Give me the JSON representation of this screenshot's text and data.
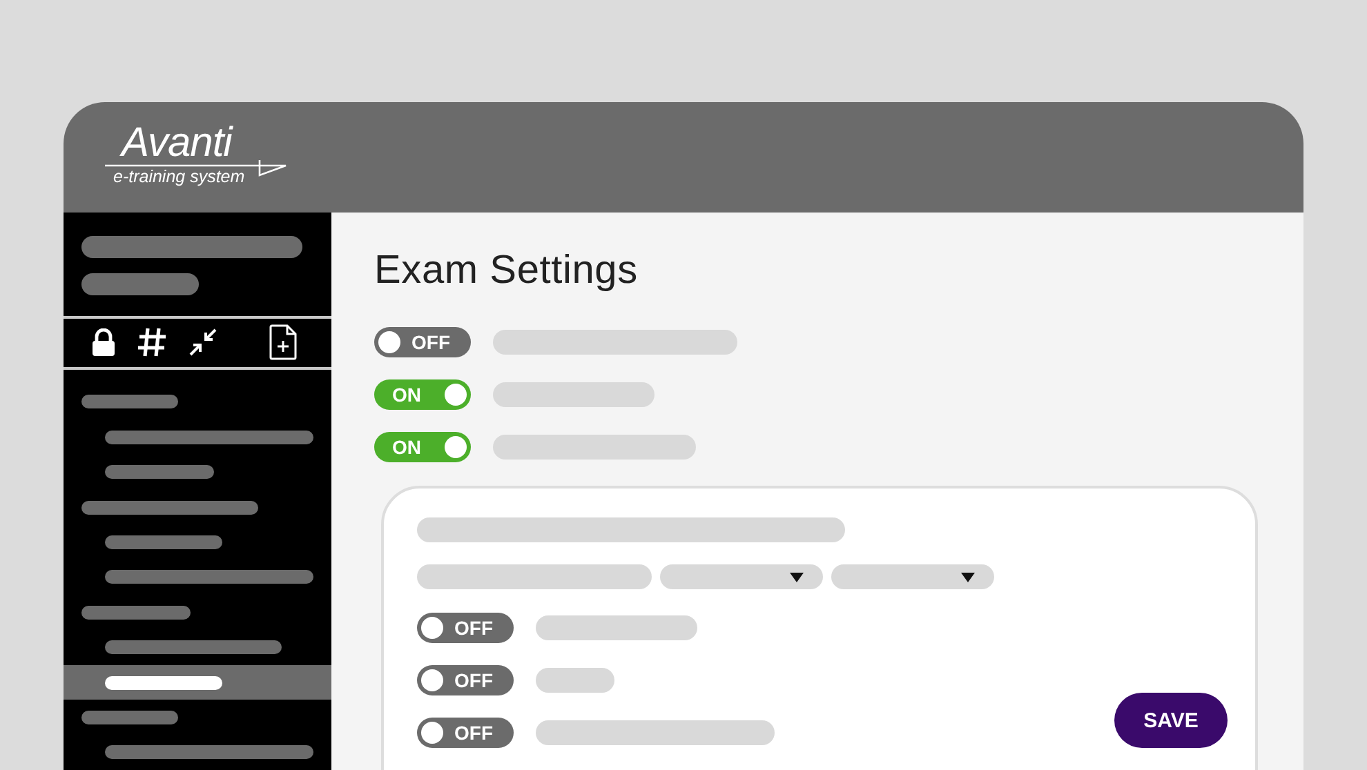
{
  "header": {
    "logo_title": "Avanti",
    "logo_subtitle": "e-training system"
  },
  "sidebar": {
    "tree": [
      {
        "selected": false,
        "children": [
          {
            "selected": false
          },
          {
            "selected": false
          }
        ]
      },
      {
        "selected": false,
        "children": [
          {
            "selected": false
          },
          {
            "selected": false
          }
        ]
      },
      {
        "selected": false,
        "children": [
          {
            "selected": false
          },
          {
            "selected": true
          }
        ]
      },
      {
        "selected": false,
        "children": [
          {
            "selected": false
          }
        ]
      }
    ]
  },
  "main": {
    "title": "Exam Settings",
    "toggles": [
      {
        "on": false,
        "label": "OFF"
      },
      {
        "on": true,
        "label": "ON"
      },
      {
        "on": true,
        "label": "ON"
      }
    ],
    "card": {
      "toggles": [
        {
          "on": false,
          "label": "OFF"
        },
        {
          "on": false,
          "label": "OFF"
        },
        {
          "on": false,
          "label": "OFF"
        }
      ],
      "save_button": "SAVE"
    }
  }
}
